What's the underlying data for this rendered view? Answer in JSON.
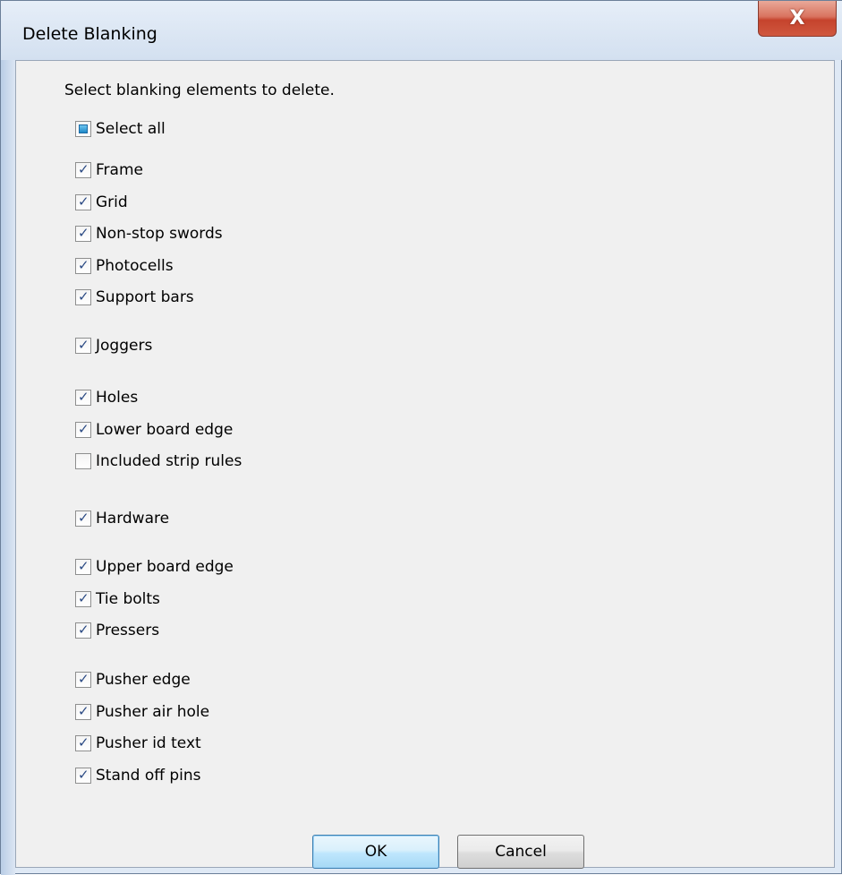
{
  "window": {
    "title": "Delete Blanking",
    "close_label": "X"
  },
  "dialog": {
    "instruction": "Select blanking elements to delete.",
    "select_all": {
      "label": "Select all",
      "state": "indeterminate"
    },
    "groups": [
      [
        {
          "label": "Frame",
          "checked": true
        },
        {
          "label": "Grid",
          "checked": true
        },
        {
          "label": "Non-stop swords",
          "checked": true
        },
        {
          "label": "Photocells",
          "checked": true
        },
        {
          "label": "Support bars",
          "checked": true
        }
      ],
      [
        {
          "label": "Joggers",
          "checked": true
        }
      ],
      [
        {
          "label": "Holes",
          "checked": true
        },
        {
          "label": "Lower board edge",
          "checked": true
        },
        {
          "label": "Included strip rules",
          "checked": false
        }
      ],
      [
        {
          "label": "Hardware",
          "checked": true
        }
      ],
      [
        {
          "label": "Upper board edge",
          "checked": true
        },
        {
          "label": "Tie bolts",
          "checked": true
        },
        {
          "label": "Pressers",
          "checked": true
        }
      ],
      [
        {
          "label": "Pusher edge",
          "checked": true
        },
        {
          "label": "Pusher air hole",
          "checked": true
        },
        {
          "label": "Pusher id text",
          "checked": true
        },
        {
          "label": "Stand off pins",
          "checked": true
        }
      ]
    ],
    "ok_label": "OK",
    "cancel_label": "Cancel"
  }
}
